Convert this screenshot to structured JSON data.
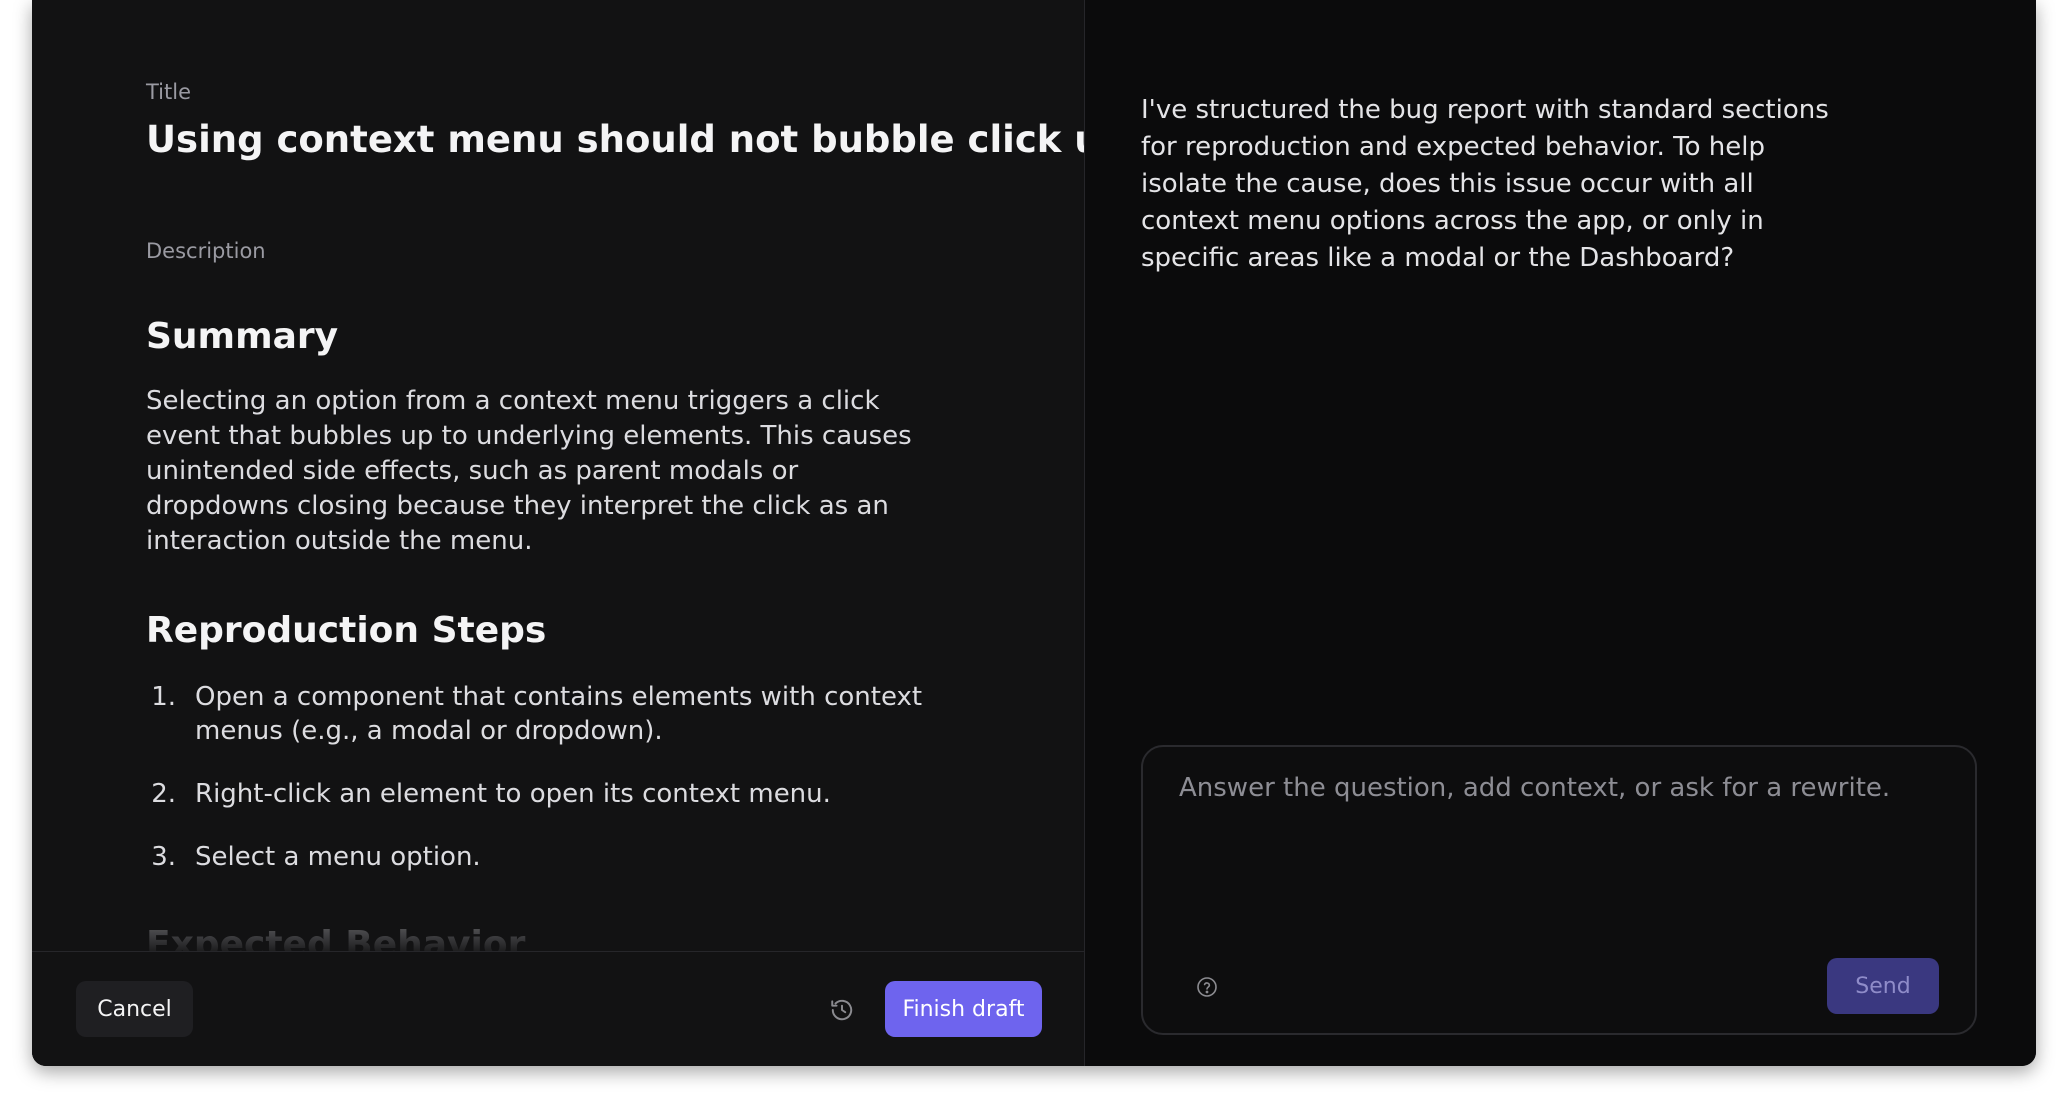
{
  "editor": {
    "title_label": "Title",
    "title": "Using context menu should not bubble click up",
    "description_label": "Description",
    "summary_heading": "Summary",
    "summary_text": "Selecting an option from a context menu triggers a click event that bubbles up to underlying elements. This causes unintended side effects, such as parent modals or dropdowns closing because they interpret the click as an interaction outside the menu.",
    "repro_heading": "Reproduction Steps",
    "steps": [
      {
        "num": "1.",
        "text": "Open a component that contains elements with context menus (e.g., a modal or dropdown)."
      },
      {
        "num": "2.",
        "text": "Right-click an element to open its context menu."
      },
      {
        "num": "3.",
        "text": "Select a menu option."
      }
    ],
    "expected_heading": "Expected Behavior"
  },
  "footer": {
    "cancel_label": "Cancel",
    "history_icon": "history-icon",
    "finish_label": "Finish draft"
  },
  "assistant": {
    "message": "I've structured the bug report with standard sections for reproduction and expected behavior. To help isolate the cause, does this issue occur with all context menu options across the app, or only in specific areas like a modal or the Dashboard?"
  },
  "composer": {
    "placeholder": "Answer the question, add context, or ask for a rewrite.",
    "value": "",
    "help_icon": "help-circle-icon",
    "send_label": "Send"
  },
  "colors": {
    "accent": "#6e64ee",
    "send_disabled": "#3a3880",
    "background": "#121213"
  }
}
